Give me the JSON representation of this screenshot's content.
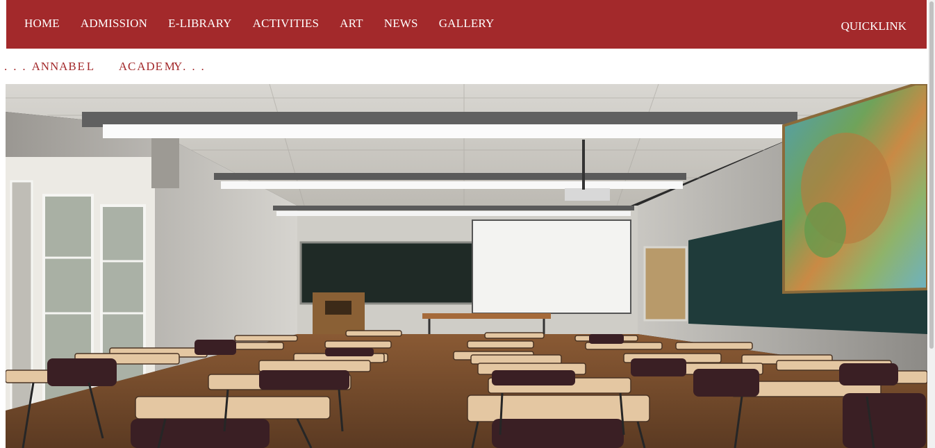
{
  "nav": {
    "items": [
      {
        "label": "HOME"
      },
      {
        "label": "ADMISSION"
      },
      {
        "label": "E-LIBRARY"
      },
      {
        "label": "ACTIVITIES"
      },
      {
        "label": "ART"
      },
      {
        "label": "NEWS"
      },
      {
        "label": "GALLERY"
      }
    ],
    "quicklink": "QUICKLINK"
  },
  "brand": {
    "text": ". . . A N N A B E L      A C A D E M Y . . ."
  },
  "hero": {
    "image_description": "classroom-photo"
  },
  "colors": {
    "accent": "#a3292b",
    "nav_text": "#ffffff"
  }
}
